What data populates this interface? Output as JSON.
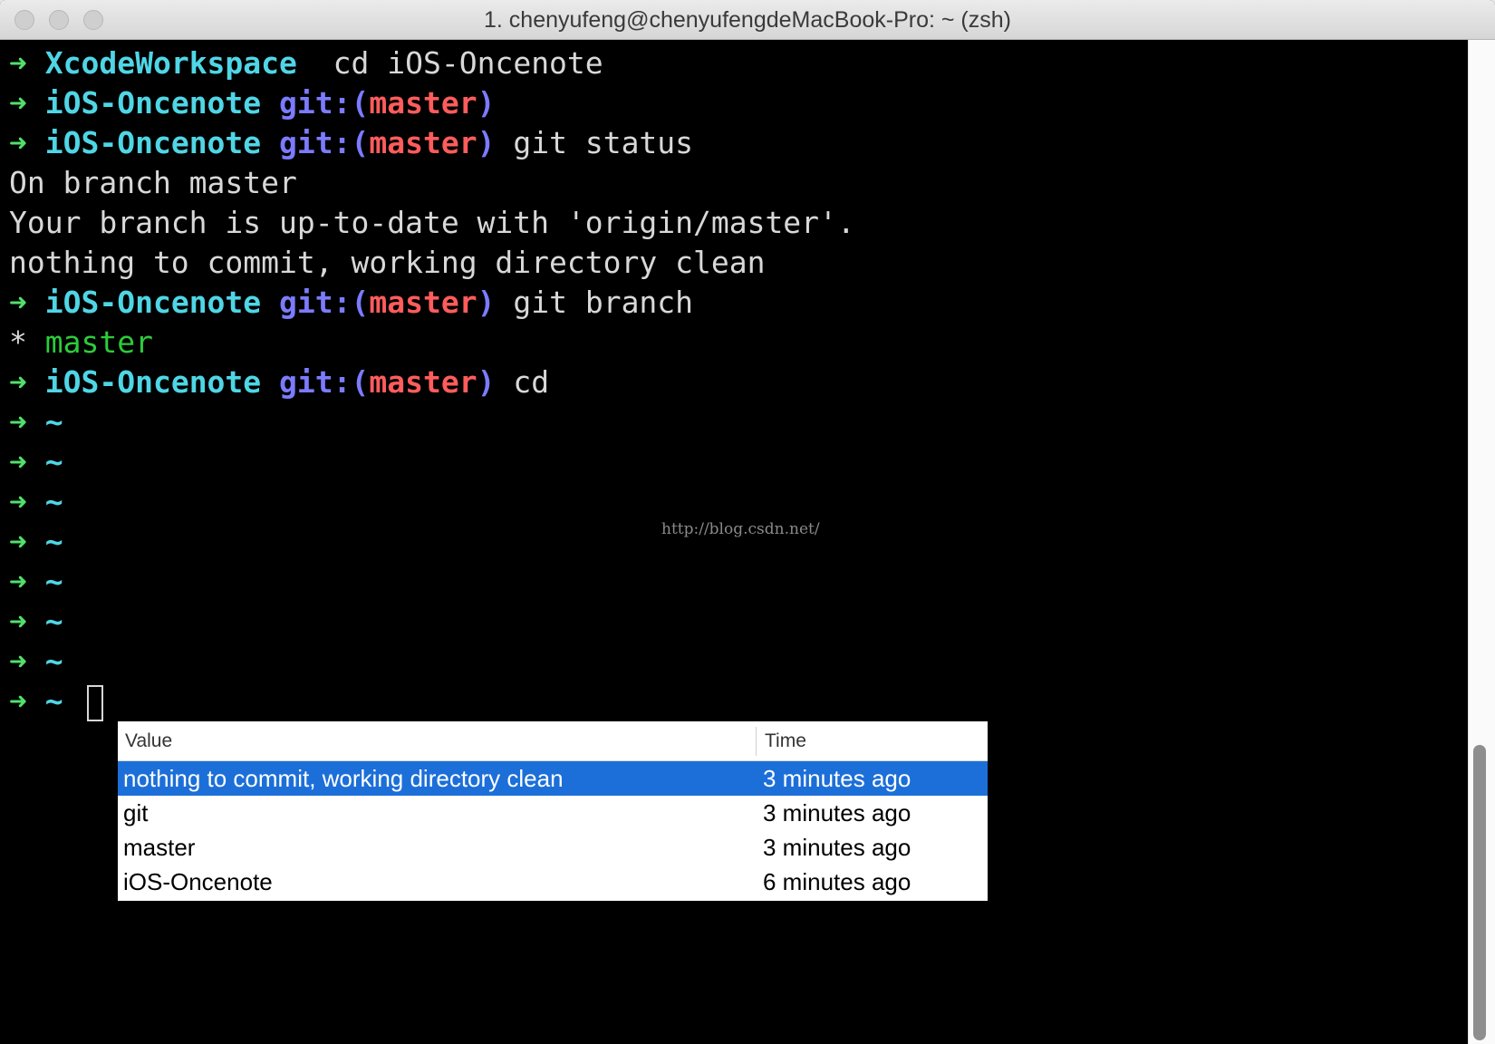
{
  "window": {
    "title": "1. chenyufeng@chenyufengdeMacBook-Pro: ~ (zsh)"
  },
  "terminal": {
    "prompt_arrow": "➜",
    "lines": [
      {
        "type": "prompt",
        "dir": "XcodeWorkspace",
        "git": "",
        "branch": "",
        "git_close": "",
        "command": " cd iOS-Oncenote"
      },
      {
        "type": "prompt",
        "dir": "iOS-Oncenote",
        "git": "git:(",
        "branch": "master",
        "git_close": ")",
        "command": ""
      },
      {
        "type": "prompt",
        "dir": "iOS-Oncenote",
        "git": "git:(",
        "branch": "master",
        "git_close": ")",
        "command": "git status"
      },
      {
        "type": "output",
        "text": "On branch master"
      },
      {
        "type": "output",
        "text": "Your branch is up-to-date with 'origin/master'."
      },
      {
        "type": "output",
        "text": "nothing to commit, working directory clean"
      },
      {
        "type": "prompt",
        "dir": "iOS-Oncenote",
        "git": "git:(",
        "branch": "master",
        "git_close": ")",
        "command": "git branch"
      },
      {
        "type": "branch",
        "star": "*",
        "branch": "master"
      },
      {
        "type": "prompt",
        "dir": "iOS-Oncenote",
        "git": "git:(",
        "branch": "master",
        "git_close": ")",
        "command": "cd"
      },
      {
        "type": "prompt",
        "dir": "~",
        "git": "",
        "branch": "",
        "git_close": "",
        "command": ""
      },
      {
        "type": "prompt",
        "dir": "~",
        "git": "",
        "branch": "",
        "git_close": "",
        "command": ""
      },
      {
        "type": "prompt",
        "dir": "~",
        "git": "",
        "branch": "",
        "git_close": "",
        "command": ""
      },
      {
        "type": "prompt",
        "dir": "~",
        "git": "",
        "branch": "",
        "git_close": "",
        "command": ""
      },
      {
        "type": "prompt",
        "dir": "~",
        "git": "",
        "branch": "",
        "git_close": "",
        "command": ""
      },
      {
        "type": "prompt",
        "dir": "~",
        "git": "",
        "branch": "",
        "git_close": "",
        "command": ""
      },
      {
        "type": "prompt",
        "dir": "~",
        "git": "",
        "branch": "",
        "git_close": "",
        "command": ""
      },
      {
        "type": "current",
        "dir": "~"
      }
    ]
  },
  "watermark": "http://blog.csdn.net/",
  "autocomplete": {
    "columns": {
      "value": "Value",
      "time": "Time"
    },
    "rows": [
      {
        "value": "nothing to commit, working directory clean",
        "time": "3 minutes ago",
        "selected": true
      },
      {
        "value": "git",
        "time": "3 minutes ago",
        "selected": false
      },
      {
        "value": "master",
        "time": "3 minutes ago",
        "selected": false
      },
      {
        "value": "iOS-Oncenote",
        "time": "6 minutes ago",
        "selected": false
      }
    ]
  },
  "colors": {
    "arrow": "#52e06b",
    "directory": "#4fd6e6",
    "git_label": "#7b7bff",
    "branch": "#ff5c5c",
    "selection": "#1c6fd8"
  }
}
